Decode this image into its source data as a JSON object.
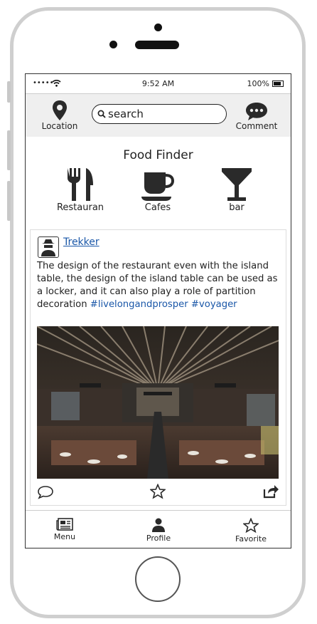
{
  "status_bar": {
    "signal": "•••••",
    "time": "9:52 AM",
    "battery": "100%"
  },
  "header": {
    "location_label": "Location",
    "search_placeholder": "search",
    "comment_label": "Comment"
  },
  "main": {
    "title": "Food Finder",
    "categories": [
      {
        "label": "Restauran",
        "icon": "restaurant-icon"
      },
      {
        "label": "Cafes",
        "icon": "coffee-cup-icon"
      },
      {
        "label": "bar",
        "icon": "cocktail-icon"
      }
    ],
    "post": {
      "username": "Trekker",
      "text": "The design of the restaurant even with the island table, the design of the island table can be used as a locker, and it can also play a role of partition decoration ",
      "hashtags": [
        "#livelongandprosper",
        "#voyager"
      ]
    }
  },
  "bottom_nav": {
    "items": [
      {
        "label": "Menu",
        "icon": "newspaper-icon"
      },
      {
        "label": "Profile",
        "icon": "user-icon"
      },
      {
        "label": "Favorite",
        "icon": "star-icon"
      }
    ]
  },
  "colors": {
    "link": "#1a57a8",
    "header_bg": "#efefef",
    "frame": "#cfcfcf"
  }
}
